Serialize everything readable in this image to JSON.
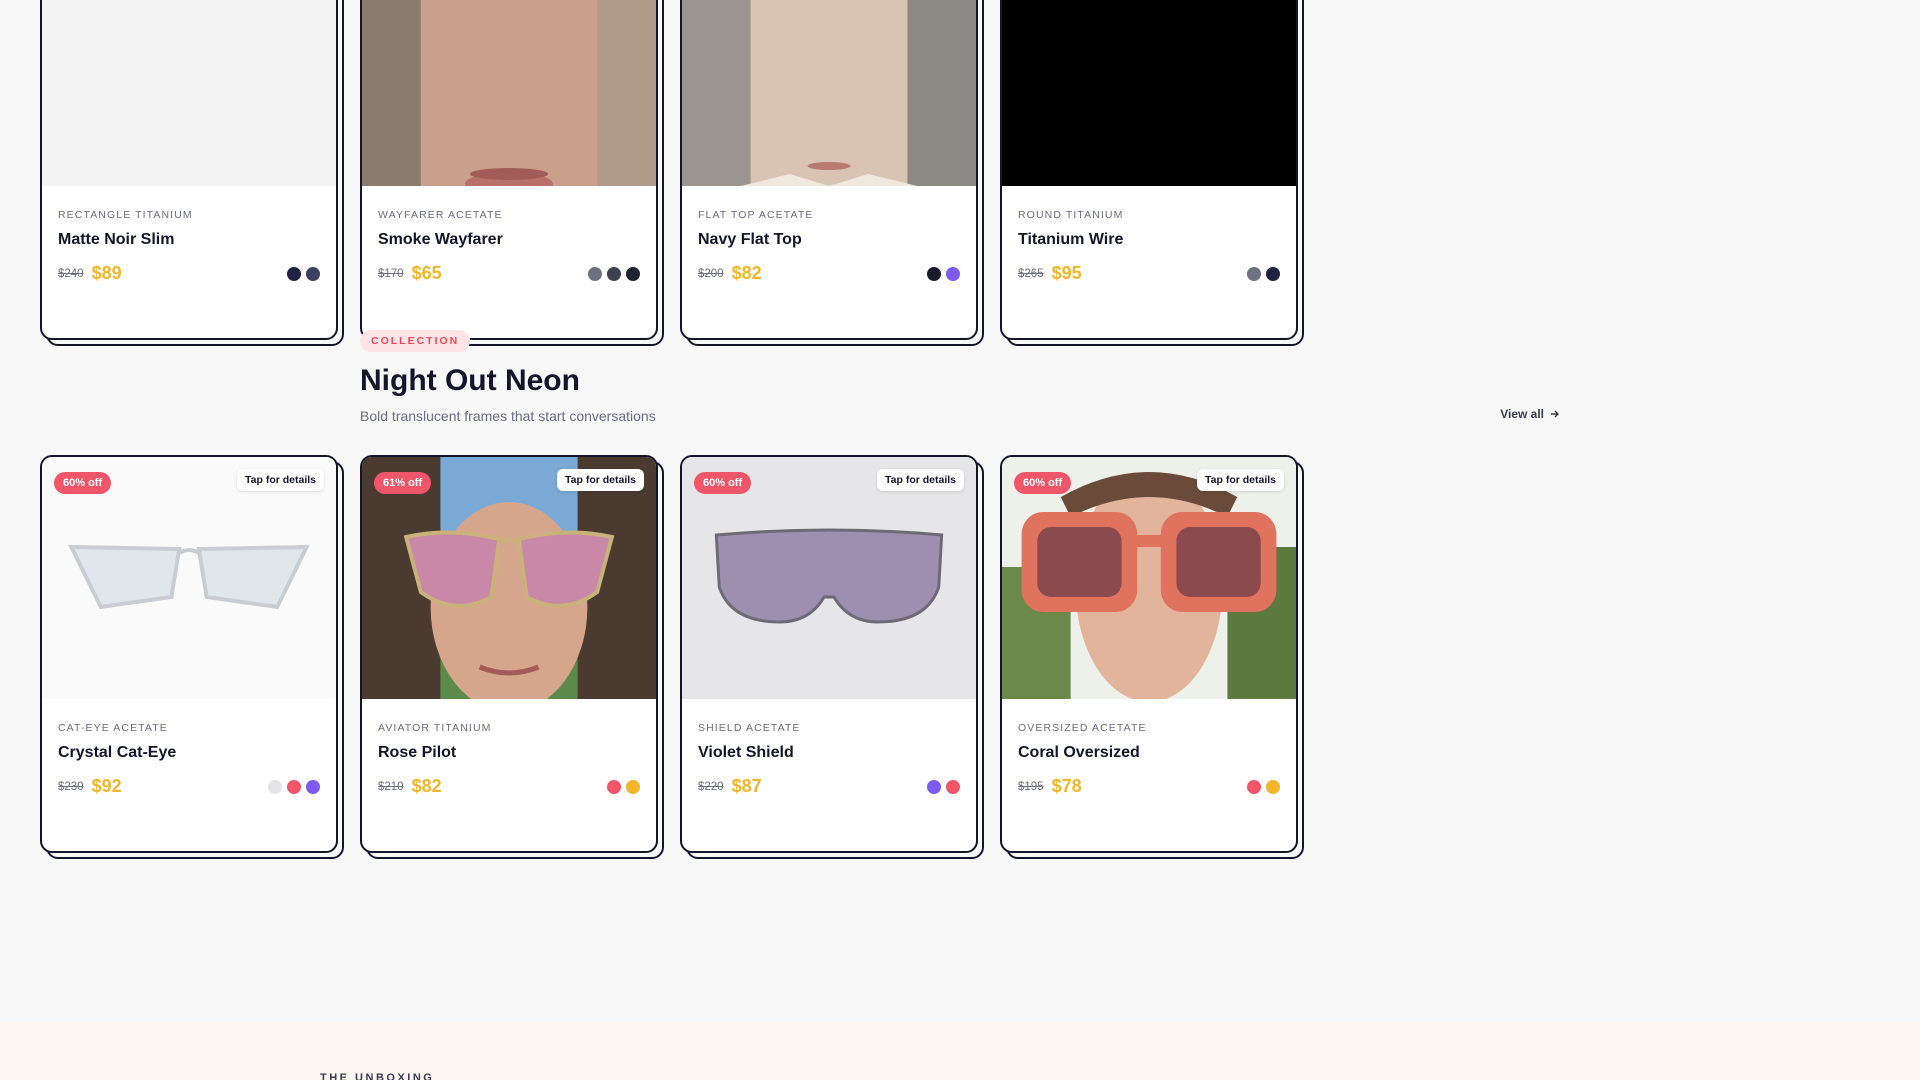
{
  "top_row": [
    {
      "category": "RECTANGLE TITANIUM",
      "name": "Matte Noir Slim",
      "old_price": "$240",
      "price": "$89",
      "swatches": [
        "#1f2340",
        "#3d4160"
      ],
      "photo": "white"
    },
    {
      "category": "WAYFARER ACETATE",
      "name": "Smoke Wayfarer",
      "old_price": "$170",
      "price": "$65",
      "swatches": [
        "#6c7280",
        "#3d4150",
        "#1f2330"
      ],
      "photo": "lips"
    },
    {
      "category": "FLAT TOP ACETATE",
      "name": "Navy Flat Top",
      "old_price": "$200",
      "price": "$82",
      "swatches": [
        "#1a1a2e",
        "#7c5cf0"
      ],
      "photo": "chin"
    },
    {
      "category": "ROUND TITANIUM",
      "name": "Titanium Wire",
      "old_price": "$265",
      "price": "$95",
      "swatches": [
        "#6c7280",
        "#1f2340"
      ],
      "photo": "black"
    }
  ],
  "collection": {
    "pill": "COLLECTION",
    "title": "Night Out Neon",
    "subtitle": "Bold translucent frames that start conversations",
    "view_all": "View all"
  },
  "bottom_row": [
    {
      "discount": "60% off",
      "tap": "Tap for details",
      "category": "CAT-EYE ACETATE",
      "name": "Crystal Cat-Eye",
      "old_price": "$230",
      "price": "$92",
      "swatches": [
        "#e4e4e8",
        "#f0566a",
        "#7c5cf0"
      ],
      "photo": "crystal"
    },
    {
      "discount": "61% off",
      "tap": "Tap for details",
      "category": "AVIATOR TITANIUM",
      "name": "Rose Pilot",
      "old_price": "$210",
      "price": "$82",
      "swatches": [
        "#f0566a",
        "#f4b52a"
      ],
      "photo": "aviator"
    },
    {
      "discount": "60% off",
      "tap": "Tap for details",
      "category": "SHIELD ACETATE",
      "name": "Violet Shield",
      "old_price": "$220",
      "price": "$87",
      "swatches": [
        "#7c5cf0",
        "#f0566a"
      ],
      "photo": "shield"
    },
    {
      "discount": "60% off",
      "tap": "Tap for details",
      "category": "OVERSIZED ACETATE",
      "name": "Coral Oversized",
      "old_price": "$195",
      "price": "$78",
      "swatches": [
        "#f0566a",
        "#f4b52a"
      ],
      "photo": "coral"
    }
  ],
  "footer": {
    "label": "THE UNBOXING"
  },
  "colors": {
    "accent_price": "#f4b52a",
    "badge": "#f0566a",
    "ink": "#14142b"
  }
}
